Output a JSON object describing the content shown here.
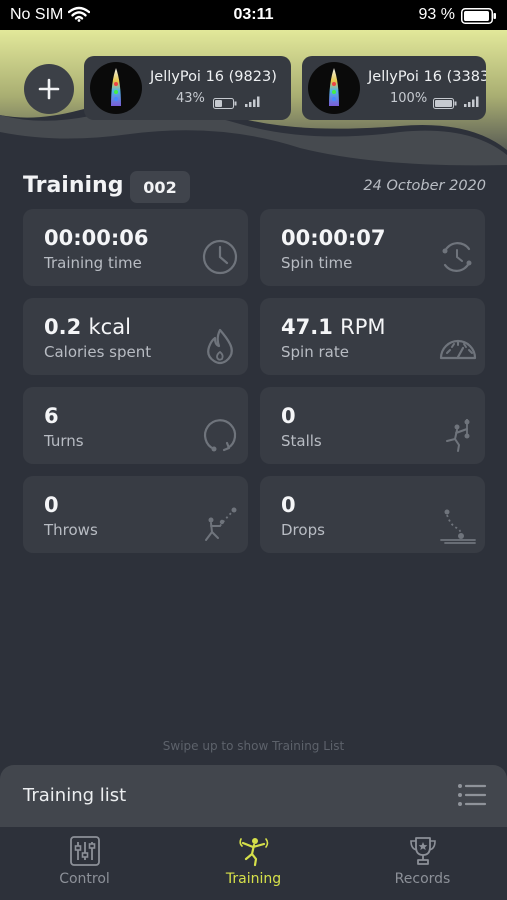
{
  "status_bar": {
    "carrier": "No SIM",
    "time": "03:11",
    "battery_percent": "93 %"
  },
  "devices": [
    {
      "name": "JellyPoi 16 (9823)",
      "battery": "43%",
      "battery_level": 0.43
    },
    {
      "name": "JellyPoi 16 (3383)",
      "battery": "100%",
      "battery_level": 1.0
    }
  ],
  "training": {
    "title": "Training",
    "session_number": "002",
    "date": "24 October 2020"
  },
  "stats": [
    {
      "value": "00:00:06",
      "unit": "",
      "label": "Training time",
      "icon": "clock-icon"
    },
    {
      "value": "00:00:07",
      "unit": "",
      "label": "Spin time",
      "icon": "spin-timer-icon"
    },
    {
      "value": "0.2",
      "unit": "kcal",
      "label": "Calories spent",
      "icon": "flame-icon"
    },
    {
      "value": "47.1",
      "unit": "RPM",
      "label": "Spin rate",
      "icon": "speedometer-icon"
    },
    {
      "value": "6",
      "unit": "",
      "label": "Turns",
      "icon": "turn-icon"
    },
    {
      "value": "0",
      "unit": "",
      "label": "Stalls",
      "icon": "stall-figure-icon"
    },
    {
      "value": "0",
      "unit": "",
      "label": "Throws",
      "icon": "throw-figure-icon"
    },
    {
      "value": "0",
      "unit": "",
      "label": "Drops",
      "icon": "drop-icon"
    }
  ],
  "swipe_hint": "Swipe up to show Training List",
  "training_list": {
    "title": "Training list"
  },
  "tabs": [
    {
      "label": "Control",
      "icon": "sliders-icon",
      "active": false
    },
    {
      "label": "Training",
      "icon": "dancer-icon",
      "active": true
    },
    {
      "label": "Records",
      "icon": "trophy-icon",
      "active": false
    }
  ],
  "colors": {
    "background": "#2d313a",
    "card": "#383c44",
    "accent": "#d6e04a",
    "header_glow": "#c9d077"
  }
}
